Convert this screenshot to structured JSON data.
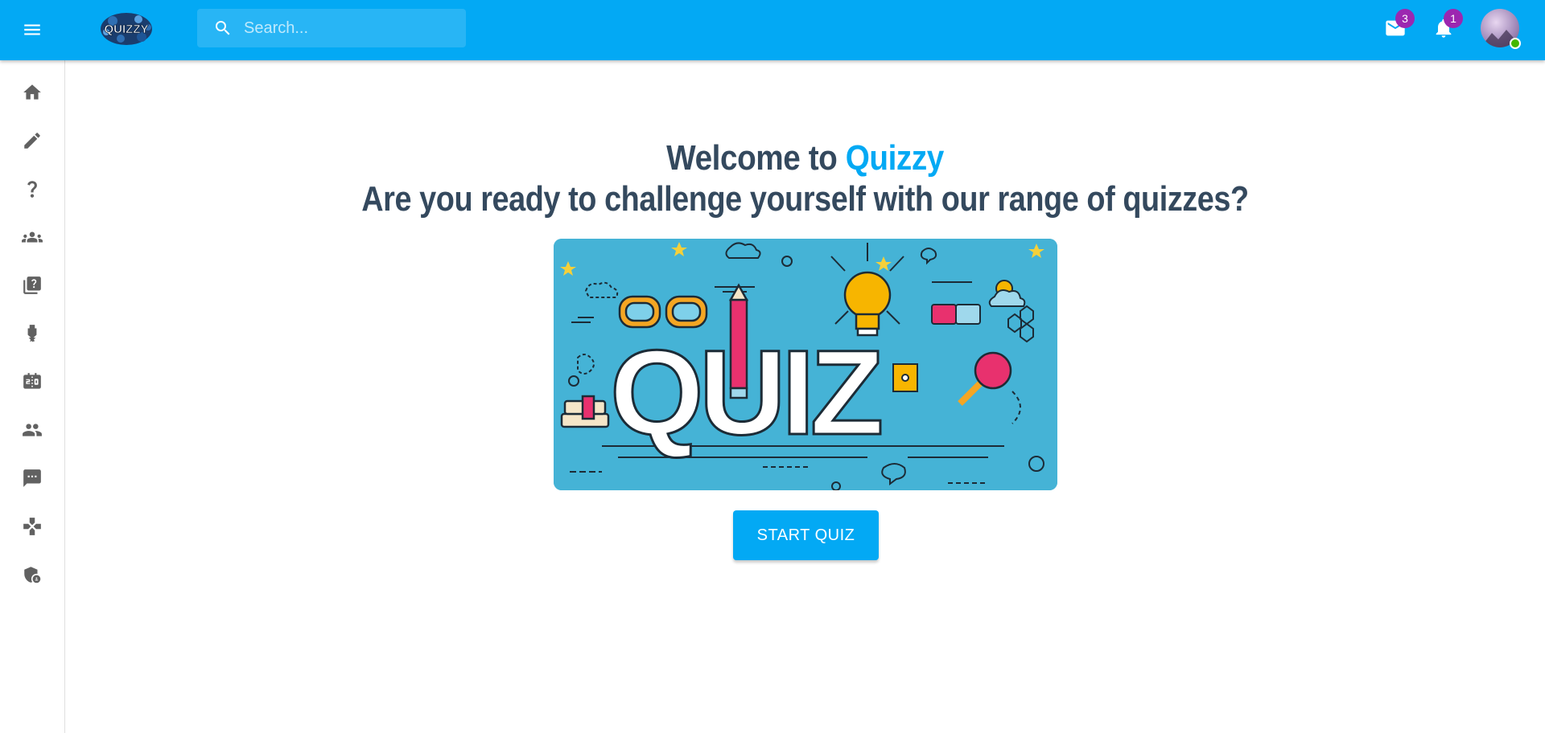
{
  "header": {
    "logo_text": "QUIZZY",
    "search_placeholder": "Search...",
    "mail_badge": "3",
    "notification_badge": "1"
  },
  "sidebar": {
    "items": [
      {
        "icon": "home-icon"
      },
      {
        "icon": "pencil-icon"
      },
      {
        "icon": "question-mark-icon"
      },
      {
        "icon": "groups-icon"
      },
      {
        "icon": "quiz-library-icon"
      },
      {
        "icon": "trophy-medal-icon"
      },
      {
        "icon": "scoreboard-icon"
      },
      {
        "icon": "people-icon"
      },
      {
        "icon": "chat-icon"
      },
      {
        "icon": "gamepad-icon"
      },
      {
        "icon": "admin-shield-icon"
      }
    ]
  },
  "main": {
    "welcome_prefix": "Welcome to ",
    "brand": "Quizzy",
    "subtitle": "Are you ready to challenge yourself with our range of quizzes?",
    "banner_word": "QUIZ",
    "start_button": "START QUIZ"
  },
  "colors": {
    "appbar": "#03a9f4",
    "heading": "#34495e",
    "brand": "#03a9f4",
    "banner_bg": "#45b3d6",
    "badge": "#9c27b0"
  }
}
